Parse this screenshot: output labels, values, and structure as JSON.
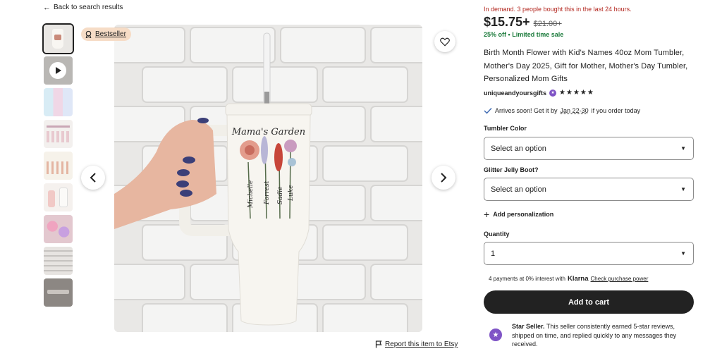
{
  "nav": {
    "back_label": "Back to search results"
  },
  "gallery": {
    "bestseller_label": "Bestseller",
    "thumbnail_count": 9
  },
  "product": {
    "demand_notice": "In demand. 3 people bought this in the last 24 hours.",
    "price": "$15.75+",
    "original_price": "$21.00+",
    "discount": "25% off",
    "sale_separator": "•",
    "sale_note": "Limited time sale",
    "title": "Birth Month Flower with Kid's Names 40oz Mom Tumbler, Mother's Day 2025, Gift for Mother, Mother's Day Tumbler, Personalized Mom Gifts",
    "shop_name": "uniqueandyoursgifts",
    "rating_stars": "★★★★★",
    "rating_value": 5
  },
  "delivery": {
    "prefix": "Arrives soon! Get it by",
    "date_range": "Jan 22-30",
    "suffix": "if you order today"
  },
  "options": {
    "tumbler_color": {
      "label": "Tumbler Color",
      "value": "Select an option"
    },
    "glitter_boot": {
      "label": "Glitter Jelly Boot?",
      "value": "Select an option"
    },
    "personalization_label": "Add personalization",
    "quantity": {
      "label": "Quantity",
      "value": "1"
    }
  },
  "payment": {
    "text": "4 payments at 0% interest with",
    "provider": "Klarna",
    "link": "Check purchase power"
  },
  "actions": {
    "add_to_cart": "Add to cart",
    "report": "Report this item to Etsy"
  },
  "star_seller": {
    "title": "Star Seller.",
    "description": "This seller consistently earned 5-star reviews, shipped on time, and replied quickly to any messages they received."
  },
  "main_image": {
    "cup_heading": "Mama's Garden",
    "cup_names": [
      "Michelle",
      "Forrest",
      "Sadie",
      "Luke"
    ]
  },
  "colors": {
    "demand_red": "#b3261e",
    "sale_green": "#1a7a3a",
    "cart_button": "#222222",
    "star_seller_purple": "#7f54c6",
    "bestseller_badge": "#f6dcc6"
  }
}
